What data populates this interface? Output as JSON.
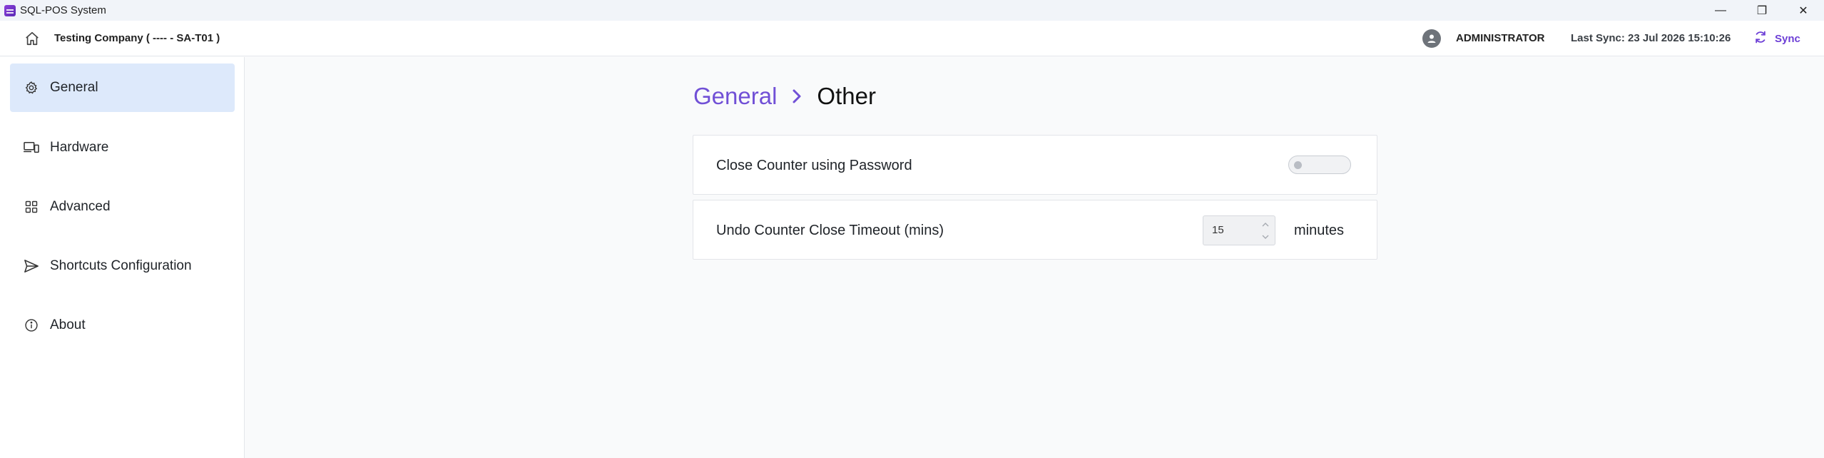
{
  "window": {
    "title": "SQL-POS System",
    "minimize_glyph": "—",
    "restore_glyph": "❐",
    "close_glyph": "✕"
  },
  "header": {
    "company": "Testing Company ( ---- - SA-T01 )",
    "user": "ADMINISTRATOR",
    "last_sync": "Last Sync: 23 Jul 2026 15:10:26",
    "sync_label": "Sync",
    "accent": "#6d3fd6"
  },
  "sidebar": {
    "items": [
      {
        "label": "General",
        "icon": "gear-icon",
        "active": true
      },
      {
        "label": "Hardware",
        "icon": "devices-icon",
        "active": false
      },
      {
        "label": "Advanced",
        "icon": "grid-icon",
        "active": false
      },
      {
        "label": "Shortcuts Configuration",
        "icon": "send-icon",
        "active": false
      },
      {
        "label": "About",
        "icon": "info-icon",
        "active": false
      }
    ],
    "active_bg": "#dde9fb"
  },
  "breadcrumb": {
    "parent": "General",
    "current": "Other",
    "parent_color": "#7150d6"
  },
  "settings": {
    "close_counter": {
      "label": "Close Counter using Password",
      "enabled": false
    },
    "undo_timeout": {
      "label": "Undo Counter Close Timeout (mins)",
      "value": "15",
      "unit": "minutes"
    }
  }
}
